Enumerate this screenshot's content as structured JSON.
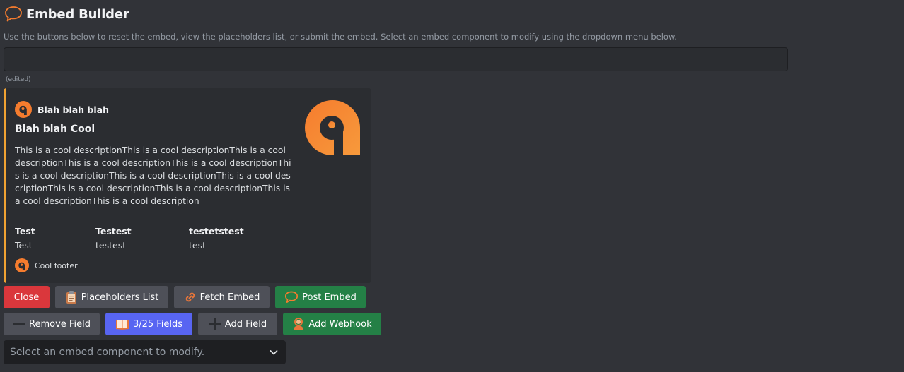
{
  "header": {
    "title": "Embed Builder",
    "icon": "speech-bubble-icon"
  },
  "subtitle": "Use the buttons below to reset the embed, view the placeholders list, or submit the embed. Select an embed component to modify using the dropdown menu below.",
  "edited_label": "(edited)",
  "embed": {
    "accent_color": "#f0a232",
    "author": {
      "name": "Blah blah blah",
      "icon": "logo-icon"
    },
    "title": "Blah blah Cool",
    "description": "This is a cool descriptionThis is a cool descriptionThis is a cool descriptionThis is a cool descriptionThis is a cool descriptionThis is a cool descriptionThis is a cool descriptionThis is a cool descriptionThis is a cool descriptionThis is a cool descriptionThis is a cool descriptionThis is a cool description",
    "fields": [
      {
        "name": "Test",
        "value": "Test"
      },
      {
        "name": "Testest",
        "value": "testest"
      },
      {
        "name": "testetstest",
        "value": "test"
      }
    ],
    "footer": {
      "text": "Cool footer",
      "icon": "logo-icon"
    },
    "thumbnail": "logo-icon"
  },
  "buttons_row1": [
    {
      "label": "Close",
      "style": "danger"
    },
    {
      "label": "Placeholders List",
      "style": "secondary",
      "icon": "clipboard-icon"
    },
    {
      "label": "Fetch Embed",
      "style": "secondary",
      "icon": "link-icon"
    },
    {
      "label": "Post Embed",
      "style": "success",
      "icon": "speech-bubble-icon"
    }
  ],
  "buttons_row2": [
    {
      "label": "Remove Field",
      "style": "secondary",
      "icon": "minus-icon"
    },
    {
      "label": "3/25 Fields",
      "style": "primary",
      "icon": "book-icon"
    },
    {
      "label": "Add Field",
      "style": "secondary",
      "icon": "plus-icon"
    },
    {
      "label": "Add Webhook",
      "style": "success",
      "icon": "person-icon"
    }
  ],
  "select": {
    "placeholder": "Select an embed component to modify."
  },
  "colors": {
    "background": "#313338",
    "orange": "#f57c2e",
    "danger": "#da373c",
    "success": "#248046",
    "primary": "#5865f2",
    "secondary": "#4e5058"
  }
}
